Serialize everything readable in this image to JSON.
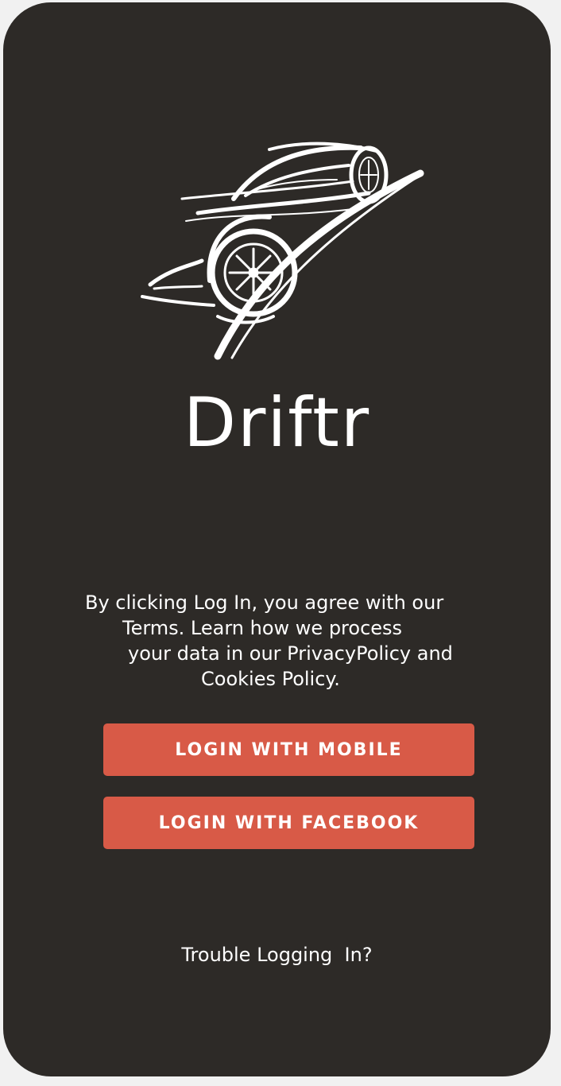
{
  "app": {
    "title": "Driftr",
    "logo_icon": "sports-car-icon"
  },
  "legal": {
    "line1": "By clicking Log In, you agree with our",
    "line2": "Terms. Learn how we process",
    "line3": "your data in our PrivacyPolicy and",
    "line4": "Cookies Policy."
  },
  "buttons": {
    "mobile_label": "LOGIN WITH MOBILE",
    "facebook_label": "LOGIN WITH FACEBOOK"
  },
  "footer": {
    "trouble_label": "Trouble Logging  In?"
  },
  "colors": {
    "background": "#2d2a27",
    "accent": "#d85a47",
    "text": "#ffffff",
    "page": "#f1f1f1"
  }
}
